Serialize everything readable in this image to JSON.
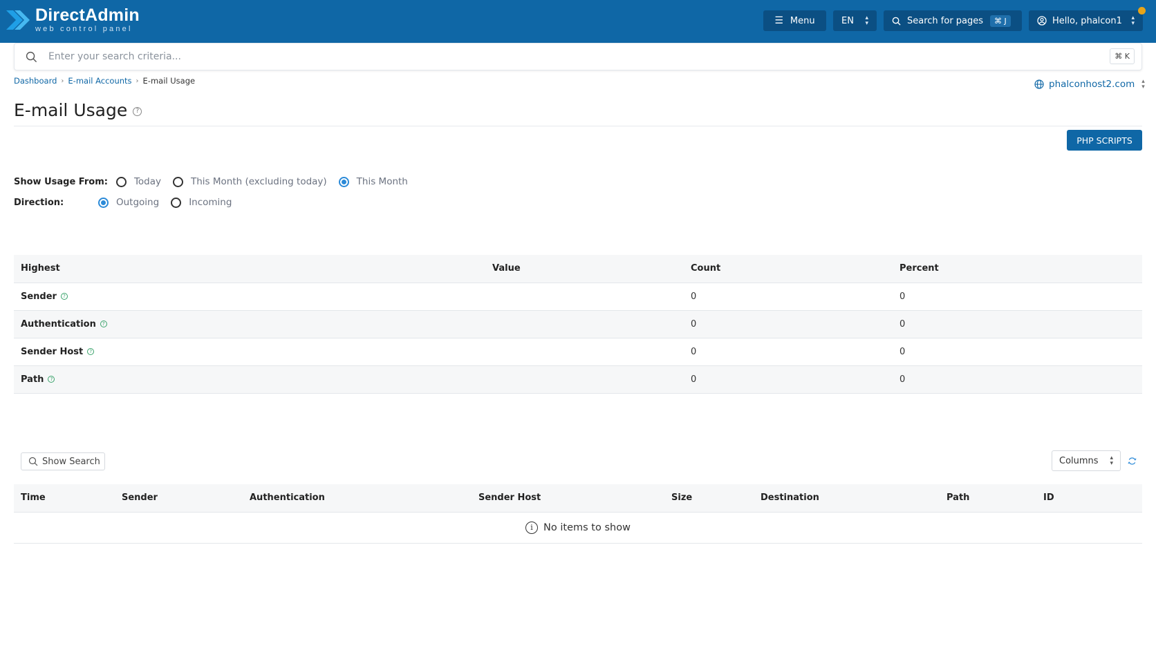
{
  "brand": {
    "title": "DirectAdmin",
    "subtitle": "web control panel"
  },
  "topbar": {
    "menu_label": "Menu",
    "lang_label": "EN",
    "search_label": "Search for pages",
    "search_shortcut": "⌘ J",
    "user_label": "Hello, phalcon1"
  },
  "search": {
    "placeholder": "Enter your search criteria...",
    "shortcut": "⌘ K"
  },
  "breadcrumb": {
    "items": [
      "Dashboard",
      "E-mail Accounts",
      "E-mail Usage"
    ]
  },
  "domain": {
    "label": "phalconhost2.com"
  },
  "page": {
    "title": "E-mail Usage",
    "help": "?"
  },
  "actions": {
    "php_scripts": "PHP SCRIPTS"
  },
  "filters": {
    "usage_from": {
      "label": "Show Usage From:",
      "options": [
        "Today",
        "This Month (excluding today)",
        "This Month"
      ],
      "selected": "This Month"
    },
    "direction": {
      "label": "Direction:",
      "options": [
        "Outgoing",
        "Incoming"
      ],
      "selected": "Outgoing"
    }
  },
  "usage_table": {
    "headers": [
      "Highest",
      "Value",
      "Count",
      "Percent"
    ],
    "rows": [
      {
        "label": "Sender",
        "value": "",
        "count": "0",
        "percent": "0"
      },
      {
        "label": "Authentication",
        "value": "",
        "count": "0",
        "percent": "0"
      },
      {
        "label": "Sender Host",
        "value": "",
        "count": "0",
        "percent": "0"
      },
      {
        "label": "Path",
        "value": "",
        "count": "0",
        "percent": "0"
      }
    ]
  },
  "log_table": {
    "show_search_label": "Show Search",
    "columns_label": "Columns",
    "headers": [
      "Time",
      "Sender",
      "Authentication",
      "Sender Host",
      "Size",
      "Destination",
      "Path",
      "ID"
    ],
    "empty_message": "No items to show"
  },
  "colors": {
    "brand_blue": "#0f67a6",
    "radio_blue": "#2b8ad8",
    "notification": "#e7a418",
    "help_green": "#3aa36b"
  }
}
